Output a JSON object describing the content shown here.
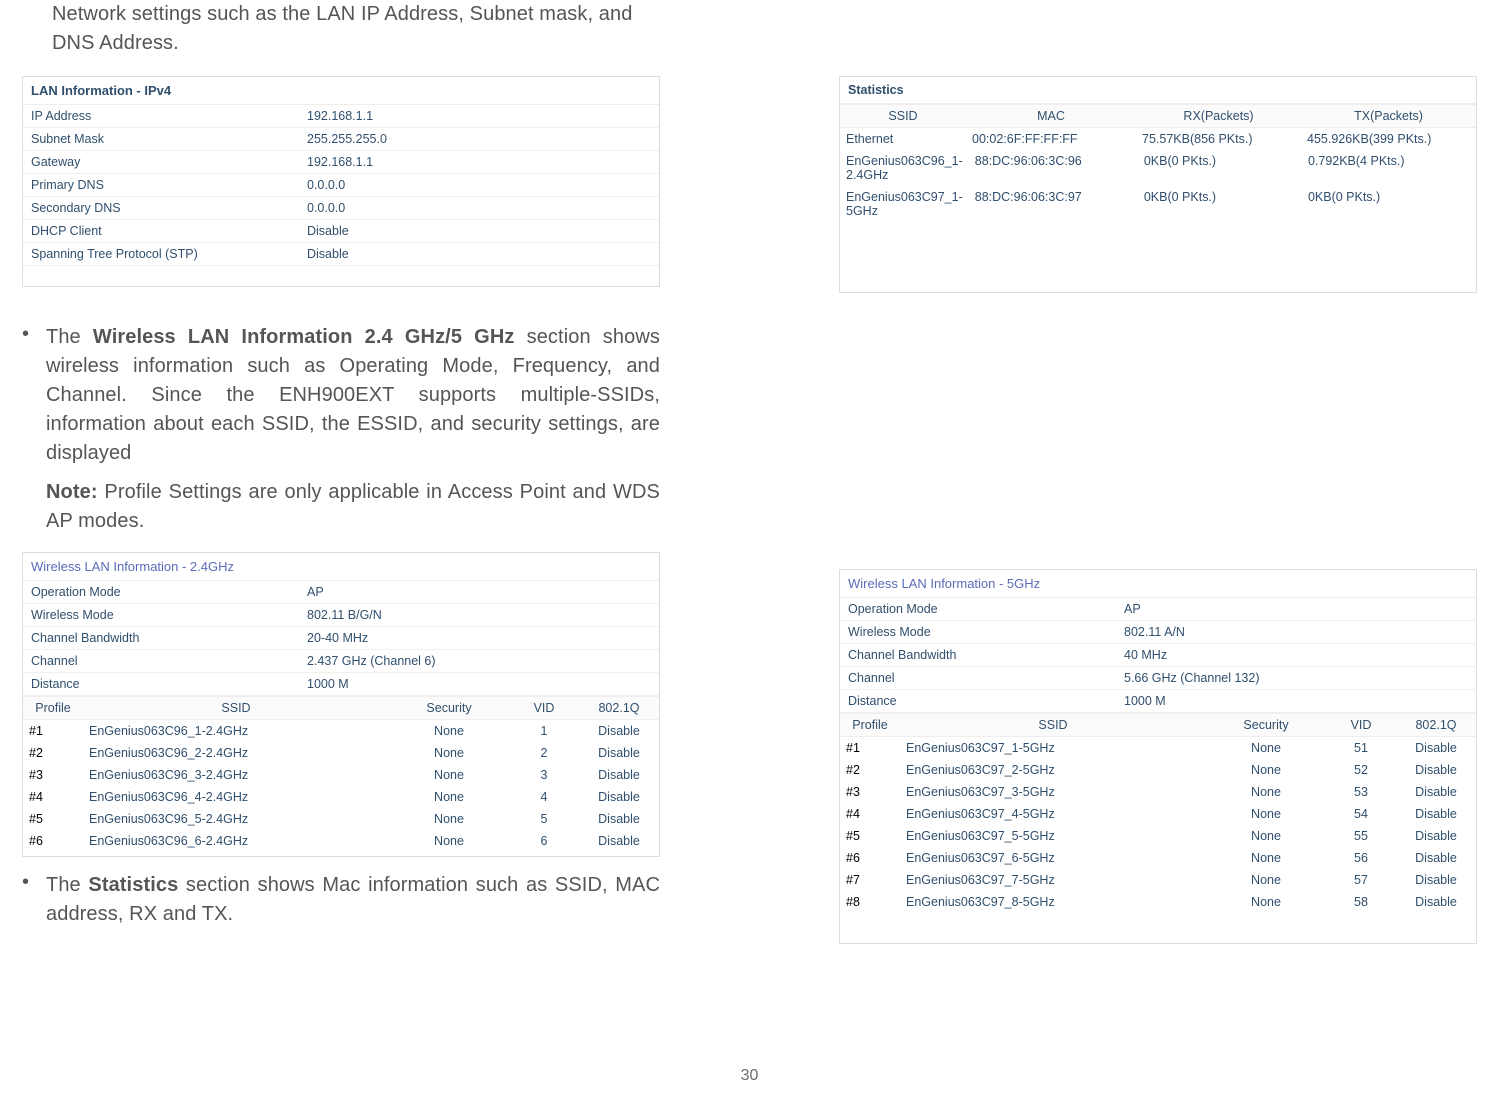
{
  "page_number": "30",
  "intro_text": "Network settings such as the LAN IP Address, Subnet mask, and DNS Address.",
  "lan_panel": {
    "title": "LAN Information - IPv4",
    "rows": [
      {
        "k": "IP Address",
        "v": "192.168.1.1"
      },
      {
        "k": "Subnet Mask",
        "v": "255.255.255.0"
      },
      {
        "k": "Gateway",
        "v": "192.168.1.1"
      },
      {
        "k": "Primary DNS",
        "v": "0.0.0.0"
      },
      {
        "k": "Secondary DNS",
        "v": "0.0.0.0"
      },
      {
        "k": "DHCP Client",
        "v": "Disable"
      },
      {
        "k": "Spanning Tree Protocol (STP)",
        "v": "Disable"
      }
    ]
  },
  "bullet_wlan_pre": "The ",
  "bullet_wlan_bold": "Wireless LAN Information 2.4 GHz/5 GHz",
  "bullet_wlan_post": " section shows wireless information such as Operating Mode, Frequency, and Channel. Since the ENH900EXT supports multiple-SSIDs, information about each SSID, the ESSID, and security settings, are displayed",
  "note_bold": "Note:",
  "note_text": " Profile Settings are only applicable in Access Point and WDS AP modes.",
  "wlan24_panel": {
    "title": "Wireless LAN Information - 2.4GHz",
    "kv": [
      {
        "k": "Operation Mode",
        "v": "AP"
      },
      {
        "k": "Wireless Mode",
        "v": "802.11 B/G/N"
      },
      {
        "k": "Channel Bandwidth",
        "v": "20-40 MHz"
      },
      {
        "k": "Channel",
        "v": "2.437 GHz (Channel 6)"
      },
      {
        "k": "Distance",
        "v": "1000 M"
      }
    ],
    "hdr": {
      "profile": "Profile",
      "ssid": "SSID",
      "security": "Security",
      "vid": "VID",
      "q": "802.1Q"
    },
    "rows": [
      {
        "p": "#1",
        "s": "EnGenius063C96_1-2.4GHz",
        "sec": "None",
        "vid": "1",
        "q": "Disable"
      },
      {
        "p": "#2",
        "s": "EnGenius063C96_2-2.4GHz",
        "sec": "None",
        "vid": "2",
        "q": "Disable"
      },
      {
        "p": "#3",
        "s": "EnGenius063C96_3-2.4GHz",
        "sec": "None",
        "vid": "3",
        "q": "Disable"
      },
      {
        "p": "#4",
        "s": "EnGenius063C96_4-2.4GHz",
        "sec": "None",
        "vid": "4",
        "q": "Disable"
      },
      {
        "p": "#5",
        "s": "EnGenius063C96_5-2.4GHz",
        "sec": "None",
        "vid": "5",
        "q": "Disable"
      },
      {
        "p": "#6",
        "s": "EnGenius063C96_6-2.4GHz",
        "sec": "None",
        "vid": "6",
        "q": "Disable"
      }
    ]
  },
  "bullet_stats_pre": "The ",
  "bullet_stats_bold": "Statistics",
  "bullet_stats_post": " section shows Mac information such as SSID, MAC address, RX and TX.",
  "stats_panel": {
    "title": "Statistics",
    "hdr": {
      "ssid": "SSID",
      "mac": "MAC",
      "rx": "RX(Packets)",
      "tx": "TX(Packets)"
    },
    "rows": [
      {
        "s": "Ethernet",
        "m": "00:02:6F:FF:FF:FF",
        "r": "75.57KB(856 PKts.)",
        "t": "455.926KB(399 PKts.)"
      },
      {
        "s": "EnGenius063C96_1-2.4GHz",
        "m": "88:DC:96:06:3C:96",
        "r": "0KB(0 PKts.)",
        "t": "0.792KB(4 PKts.)"
      },
      {
        "s": "EnGenius063C97_1-5GHz",
        "m": "88:DC:96:06:3C:97",
        "r": "0KB(0 PKts.)",
        "t": "0KB(0 PKts.)"
      }
    ]
  },
  "wlan5_panel": {
    "title": "Wireless LAN Information - 5GHz",
    "kv": [
      {
        "k": "Operation Mode",
        "v": "AP"
      },
      {
        "k": "Wireless Mode",
        "v": "802.11 A/N"
      },
      {
        "k": "Channel Bandwidth",
        "v": "40 MHz"
      },
      {
        "k": "Channel",
        "v": "5.66 GHz (Channel 132)"
      },
      {
        "k": "Distance",
        "v": "1000 M"
      }
    ],
    "hdr": {
      "profile": "Profile",
      "ssid": "SSID",
      "security": "Security",
      "vid": "VID",
      "q": "802.1Q"
    },
    "rows": [
      {
        "p": "#1",
        "s": "EnGenius063C97_1-5GHz",
        "sec": "None",
        "vid": "51",
        "q": "Disable"
      },
      {
        "p": "#2",
        "s": "EnGenius063C97_2-5GHz",
        "sec": "None",
        "vid": "52",
        "q": "Disable"
      },
      {
        "p": "#3",
        "s": "EnGenius063C97_3-5GHz",
        "sec": "None",
        "vid": "53",
        "q": "Disable"
      },
      {
        "p": "#4",
        "s": "EnGenius063C97_4-5GHz",
        "sec": "None",
        "vid": "54",
        "q": "Disable"
      },
      {
        "p": "#5",
        "s": "EnGenius063C97_5-5GHz",
        "sec": "None",
        "vid": "55",
        "q": "Disable"
      },
      {
        "p": "#6",
        "s": "EnGenius063C97_6-5GHz",
        "sec": "None",
        "vid": "56",
        "q": "Disable"
      },
      {
        "p": "#7",
        "s": "EnGenius063C97_7-5GHz",
        "sec": "None",
        "vid": "57",
        "q": "Disable"
      },
      {
        "p": "#8",
        "s": "EnGenius063C97_8-5GHz",
        "sec": "None",
        "vid": "58",
        "q": "Disable"
      }
    ]
  }
}
